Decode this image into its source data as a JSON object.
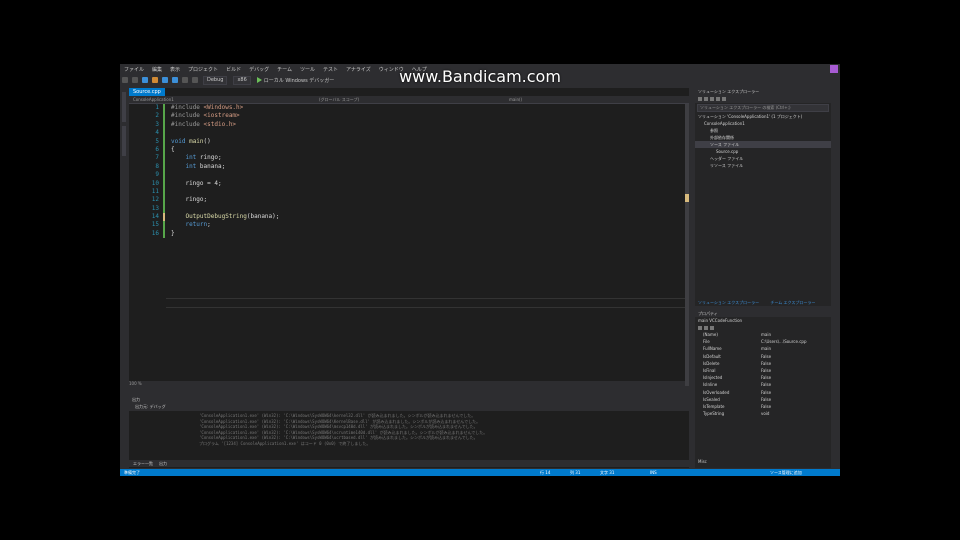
{
  "watermark": "www.Bandicam.com",
  "menu": [
    "ファイル",
    "編集",
    "表示",
    "プロジェクト",
    "ビルド",
    "デバッグ",
    "チーム",
    "ツール",
    "テスト",
    "アナライズ",
    "ウィンドウ",
    "ヘルプ"
  ],
  "window_title": "",
  "toolbar": {
    "config": "Debug",
    "platform": "x86",
    "run_label": "ローカル Windows デバッガー"
  },
  "editor": {
    "tab_label": "Source.cpp",
    "nav_left": "ConsoleApplication1",
    "nav_mid": "(グローバル スコープ)",
    "nav_right": "main()",
    "lines": [
      {
        "n": "1",
        "html": "<span class='pp'>#include</span> <span class='str'>&lt;Windows.h&gt;</span>"
      },
      {
        "n": "2",
        "html": "<span class='pp'>#include</span> <span class='str'>&lt;iostream&gt;</span>"
      },
      {
        "n": "3",
        "html": "<span class='pp'>#include</span> <span class='str'>&lt;stdio.h&gt;</span>"
      },
      {
        "n": "4",
        "html": ""
      },
      {
        "n": "5",
        "html": "<span class='kw'>void</span> <span class='fn'>main</span><span class='id'>()</span>"
      },
      {
        "n": "6",
        "html": "<span class='id'>{</span>"
      },
      {
        "n": "7",
        "html": "    <span class='kw'>int</span> <span class='id'>ringo;</span>"
      },
      {
        "n": "8",
        "html": "    <span class='kw'>int</span> <span class='id'>banana;</span>"
      },
      {
        "n": "9",
        "html": ""
      },
      {
        "n": "10",
        "html": "    <span class='id'>ringo = 4;</span>"
      },
      {
        "n": "11",
        "html": ""
      },
      {
        "n": "12",
        "html": "    <span class='id'>ringo;</span>"
      },
      {
        "n": "13",
        "html": ""
      },
      {
        "n": "14",
        "html": "    <span class='fn'>OutputDebugString</span><span class='id'>(banana);</span>"
      },
      {
        "n": "15",
        "html": "    <span class='kw'>return</span><span class='id'>;</span>"
      },
      {
        "n": "16",
        "html": "<span class='id'>}</span>"
      }
    ],
    "zoom": "100 %"
  },
  "output": {
    "title": "出力",
    "source_label": "出力元: デバッグ",
    "lines": [
      "'ConsoleApplication1.exe' (Win32): 'C:\\Windows\\SysWOW64\\kernel32.dll' が読み込まれました。シンボルが読み込まれませんでした。",
      "'ConsoleApplication1.exe' (Win32): 'C:\\Windows\\SysWOW64\\KernelBase.dll' が読み込まれました。シンボルが読み込まれませんでした。",
      "'ConsoleApplication1.exe' (Win32): 'C:\\Windows\\SysWOW64\\msvcp140d.dll' が読み込まれました。シンボルが読み込まれませんでした。",
      "'ConsoleApplication1.exe' (Win32): 'C:\\Windows\\SysWOW64\\vcruntime140d.dll' が読み込まれました。シンボルが読み込まれませんでした。",
      "'ConsoleApplication1.exe' (Win32): 'C:\\Windows\\SysWOW64\\ucrtbased.dll' が読み込まれました。シンボルが読み込まれませんでした。",
      "プログラム '[1234] ConsoleApplication1.exe' はコード 0 (0x0) で終了しました。"
    ]
  },
  "bottom_tabs": [
    "エラー一覧",
    "出力"
  ],
  "status": {
    "left": "準備完了",
    "ln": "行 14",
    "col": "列 31",
    "ch": "文字 31",
    "ins": "INS",
    "right": "ソース管理に追加"
  },
  "solution_explorer": {
    "title": "ソリューション エクスプローラー",
    "search_placeholder": "ソリューション エクスプローラー の検索 (Ctrl+;)",
    "items": [
      {
        "label": "ソリューション 'ConsoleApplication1' (1 プロジェクト)",
        "indent": 0
      },
      {
        "label": "ConsoleApplication1",
        "indent": 1
      },
      {
        "label": "参照",
        "indent": 2
      },
      {
        "label": "外部依存関係",
        "indent": 2
      },
      {
        "label": "ソース ファイル",
        "indent": 2
      },
      {
        "label": "Source.cpp",
        "indent": 3
      },
      {
        "label": "ヘッダー ファイル",
        "indent": 2
      },
      {
        "label": "リソース ファイル",
        "indent": 2
      }
    ],
    "tabs": [
      "ソリューション エクスプローラー",
      "チーム エクスプローラー"
    ]
  },
  "properties": {
    "title": "プロパティ",
    "selector": "main VCCodeFunction",
    "rows": [
      {
        "k": "(Name)",
        "v": "main"
      },
      {
        "k": "File",
        "v": "C:\\Users\\...\\Source.cpp"
      },
      {
        "k": "FullName",
        "v": "main"
      },
      {
        "k": "IsDefault",
        "v": "False"
      },
      {
        "k": "IsDelete",
        "v": "False"
      },
      {
        "k": "IsFinal",
        "v": "False"
      },
      {
        "k": "IsInjected",
        "v": "False"
      },
      {
        "k": "IsInline",
        "v": "False"
      },
      {
        "k": "IsOverloaded",
        "v": "False"
      },
      {
        "k": "IsSealed",
        "v": "False"
      },
      {
        "k": "IsTemplate",
        "v": "False"
      },
      {
        "k": "TypeString",
        "v": "void"
      }
    ],
    "desc": "Misc"
  }
}
